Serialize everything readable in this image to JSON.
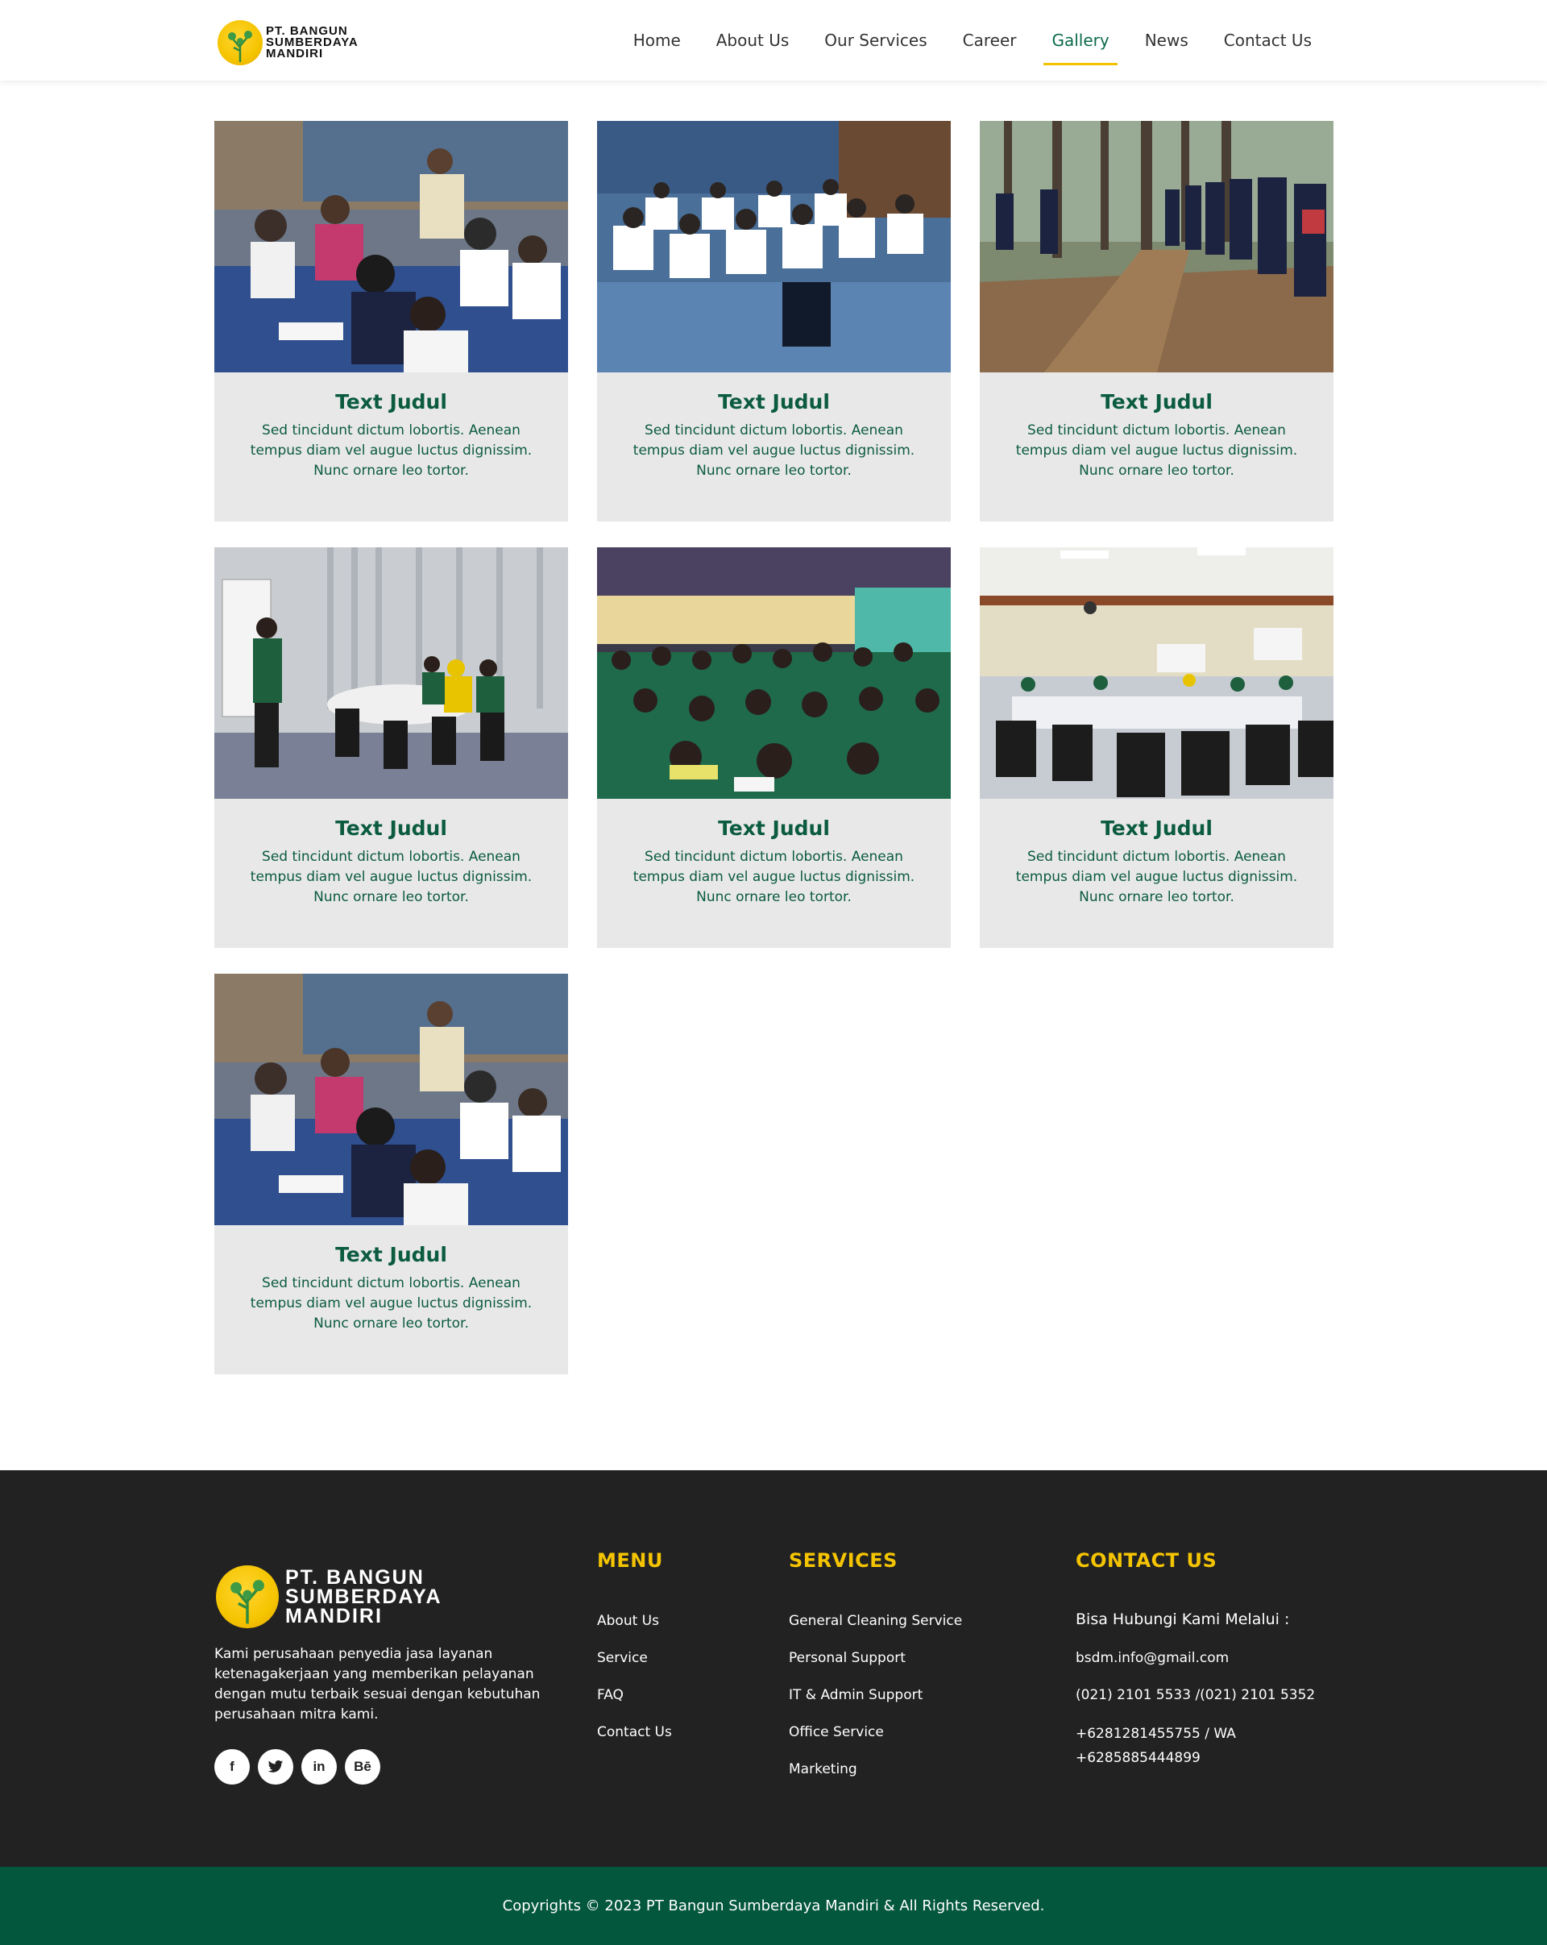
{
  "brand": {
    "logo_lines": [
      "PT. BANGUN",
      "SUMBERDAYA",
      "MANDIRI"
    ],
    "colors": {
      "primary_green": "#0b5b3f",
      "accent_yellow": "#f5c400",
      "footer_bg": "#222222",
      "copyright_bg": "#03573c"
    }
  },
  "nav": {
    "items": [
      {
        "label": "Home"
      },
      {
        "label": "About Us"
      },
      {
        "label": "Our Services"
      },
      {
        "label": "Career"
      },
      {
        "label": "Gallery",
        "active": true
      },
      {
        "label": "News"
      },
      {
        "label": "Contact Us"
      }
    ]
  },
  "gallery": {
    "cards": [
      {
        "title": "Text Judul",
        "description": "Sed tincidunt dictum lobortis. Aenean tempus diam vel augue luctus dignissim. Nunc ornare leo tortor.",
        "photo": "classroom-students-writing"
      },
      {
        "title": "Text Judul",
        "description": "Sed tincidunt dictum lobortis. Aenean tempus diam vel augue luctus dignissim. Nunc ornare leo tortor.",
        "photo": "hall-white-shirts"
      },
      {
        "title": "Text Judul",
        "description": "Sed tincidunt dictum lobortis. Aenean tempus diam vel augue luctus dignissim. Nunc ornare leo tortor.",
        "photo": "forest-lineup"
      },
      {
        "title": "Text Judul",
        "description": "Sed tincidunt dictum lobortis. Aenean tempus diam vel augue luctus dignissim. Nunc ornare leo tortor.",
        "photo": "presenter-meeting-room"
      },
      {
        "title": "Text Judul",
        "description": "Sed tincidunt dictum lobortis. Aenean tempus diam vel augue luctus dignissim. Nunc ornare leo tortor.",
        "photo": "auditorium-green-uniforms"
      },
      {
        "title": "Text Judul",
        "description": "Sed tincidunt dictum lobortis. Aenean tempus diam vel augue luctus dignissim. Nunc ornare leo tortor.",
        "photo": "training-room-tables"
      },
      {
        "title": "Text Judul",
        "description": "Sed tincidunt dictum lobortis. Aenean tempus diam vel augue luctus dignissim. Nunc ornare leo tortor.",
        "photo": "classroom-students-writing"
      }
    ]
  },
  "footer": {
    "about": "Kami perusahaan penyedia jasa layanan ketenagakerjaan yang memberikan pelayanan dengan mutu terbaik sesuai dengan kebutuhan perusahaan mitra kami.",
    "socials": [
      {
        "icon": "facebook-icon",
        "glyph": "f"
      },
      {
        "icon": "twitter-icon",
        "glyph": ""
      },
      {
        "icon": "linkedin-icon",
        "glyph": "in"
      },
      {
        "icon": "behance-icon",
        "glyph": "Bē"
      }
    ],
    "menu": {
      "heading": "MENU",
      "links": [
        "About Us",
        "Service",
        "FAQ",
        "Contact Us"
      ]
    },
    "services": {
      "heading": "SERVICES",
      "links": [
        "General Cleaning Service",
        "Personal Support",
        "IT & Admin Support",
        "Office Service",
        "Marketing"
      ]
    },
    "contact": {
      "heading": "CONTACT US",
      "intro": "Bisa Hubungi Kami Melalui :",
      "email": "bsdm.info@gmail.com",
      "phone": "(021) 2101 5533 /(021) 2101 5352",
      "wa_line1": "+6281281455755 / WA",
      "wa_line2": "+6285885444899"
    }
  },
  "copyright": "Copyrights © 2023 PT Bangun Sumberdaya Mandiri & All Rights Reserved."
}
